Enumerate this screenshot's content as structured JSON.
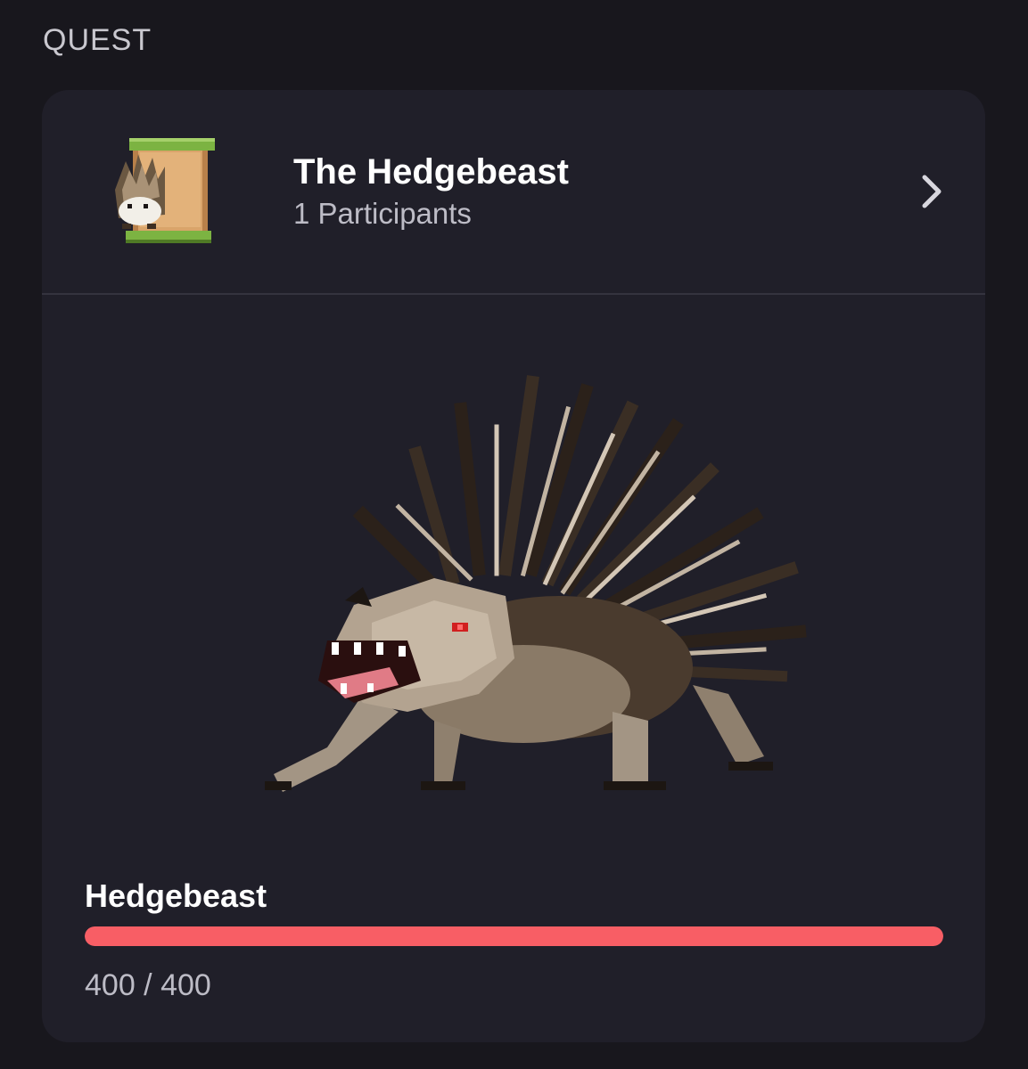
{
  "section": {
    "title": "QUEST"
  },
  "quest": {
    "name": "The Hedgebeast",
    "participants_label": "1 Participants",
    "scroll_icon": "quest-scroll-icon",
    "chevron_icon": "chevron-right-icon"
  },
  "boss": {
    "name": "Hedgebeast",
    "health_current": "400",
    "health_separator": " / ",
    "health_max": "400",
    "health_fraction": 1.0,
    "sprite": "hedgebeast-icon"
  },
  "colors": {
    "background": "#18171d",
    "card": "#201f29",
    "health_bar": "#f85e65",
    "secondary_text": "#bdbcc6"
  }
}
